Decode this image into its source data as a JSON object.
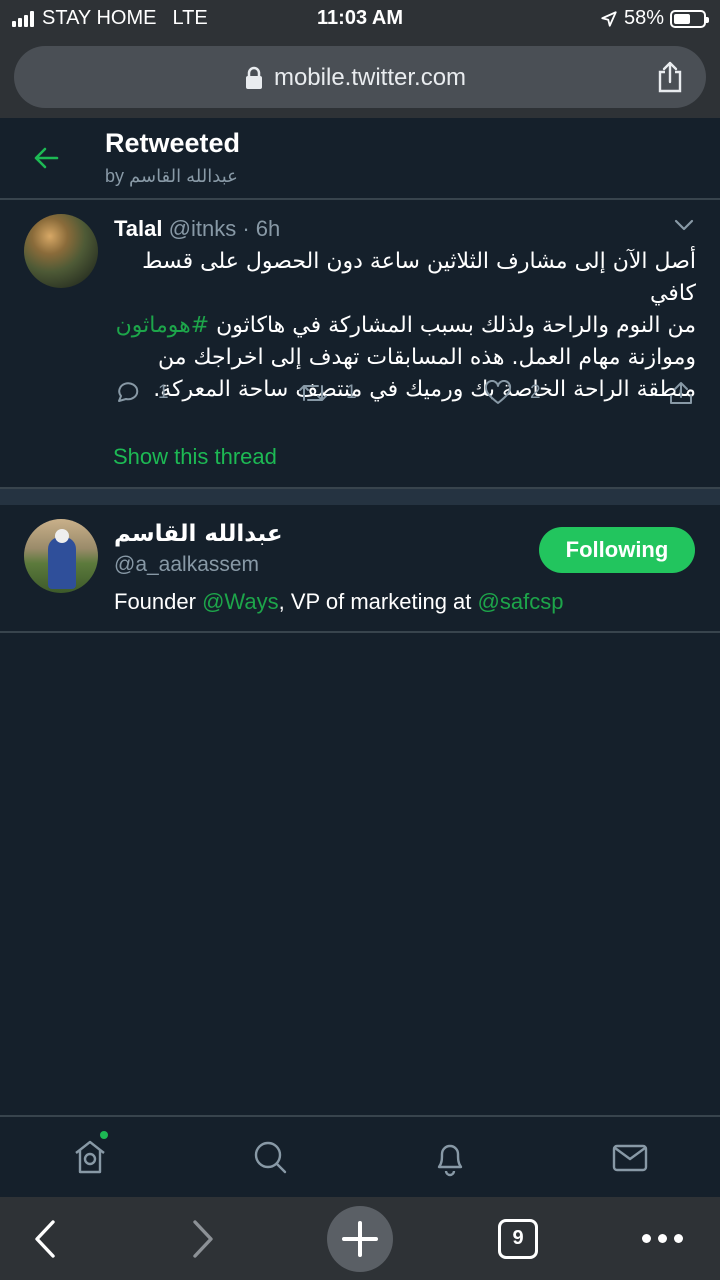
{
  "status_bar": {
    "carrier": "STAY HOME",
    "network": "LTE",
    "time": "11:03 AM",
    "battery": "58%",
    "battery_level": 0.58
  },
  "browser": {
    "url": "mobile.twitter.com",
    "tab_count": "9"
  },
  "header": {
    "title": "Retweeted",
    "subtitle": "by عبدالله القاسم"
  },
  "tweet": {
    "author_name": "Talal",
    "author_meta": "@itnks · 6h",
    "body_line1": "أصل الآن إلى مشارف الثلاثين ساعة دون الحصول على قسط كافي",
    "body_line2_pre": "من النوم والراحة ولذلك بسبب المشاركة في هاكاثون",
    "hashtag": "#هوماثون",
    "body_line3": "وموازنة مهام العمل. هذه المسابقات تهدف إلى اخراجك من",
    "body_line4": "منطقة الراحة الخاصة بك ورميك في منتصف ساحة المعركة.",
    "replies": "1",
    "retweets": "1",
    "likes": "2",
    "show_thread": "Show this thread"
  },
  "profile": {
    "name": "عبدالله القاسم",
    "handle": "@a_aalkassem",
    "bio_pre": "Founder ",
    "bio_mention1": "@Ways",
    "bio_mid": ", VP of marketing at ",
    "bio_mention2": "@safcsp",
    "follow_label": "Following"
  },
  "colors": {
    "background": "#15202b",
    "accent": "#1da54a",
    "secondary_text": "#8899a6"
  }
}
